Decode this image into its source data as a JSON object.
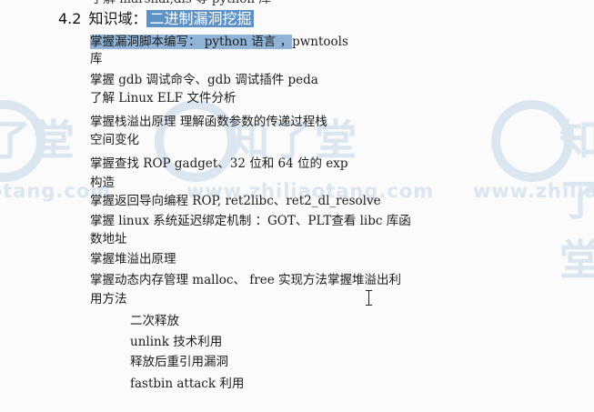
{
  "document": {
    "cut_top_line": "了解 marshal,dis 等 python 库",
    "heading": {
      "number": "4.2",
      "label": "知识域：",
      "highlighted": "二进制漏洞挖掘"
    },
    "first_item": {
      "highlighted_part": "掌握漏洞脚本编写： python 语言  ，",
      "rest": "pwntools"
    },
    "lines": [
      "库",
      "掌握 gdb 调试命令、gdb 调试插件 peda",
      "了解 Linux  ELF 文件分析",
      "掌握栈溢出原理 理解函数参数的传递过程栈",
      "空间变化",
      "掌握查找 ROP  gadget、32 位和 64 位的 exp",
      "构造",
      "掌握返回导向编程 ROP, ret2libc、ret2_dl_resolve",
      "掌握 linux 系统延迟绑定机制 ：GOT、PLT查看 libc 库函",
      "数地址",
      "掌握堆溢出原理",
      "掌握动态内存管理 malloc、  free 实现方法掌握堆溢出利",
      "用方法"
    ],
    "subitems": [
      "二次释放",
      "unlink 技术利用",
      "释放后重引用漏洞",
      "fastbin  attack 利用"
    ]
  },
  "watermark": {
    "brand_text": "知了堂",
    "url_text": "www.zhiliaotang.com",
    "color": "#dbe6f0"
  },
  "colors": {
    "heading_highlight": "#5c92c6",
    "selection_highlight": "#8fb4d8",
    "text": "#1c1c1c"
  }
}
